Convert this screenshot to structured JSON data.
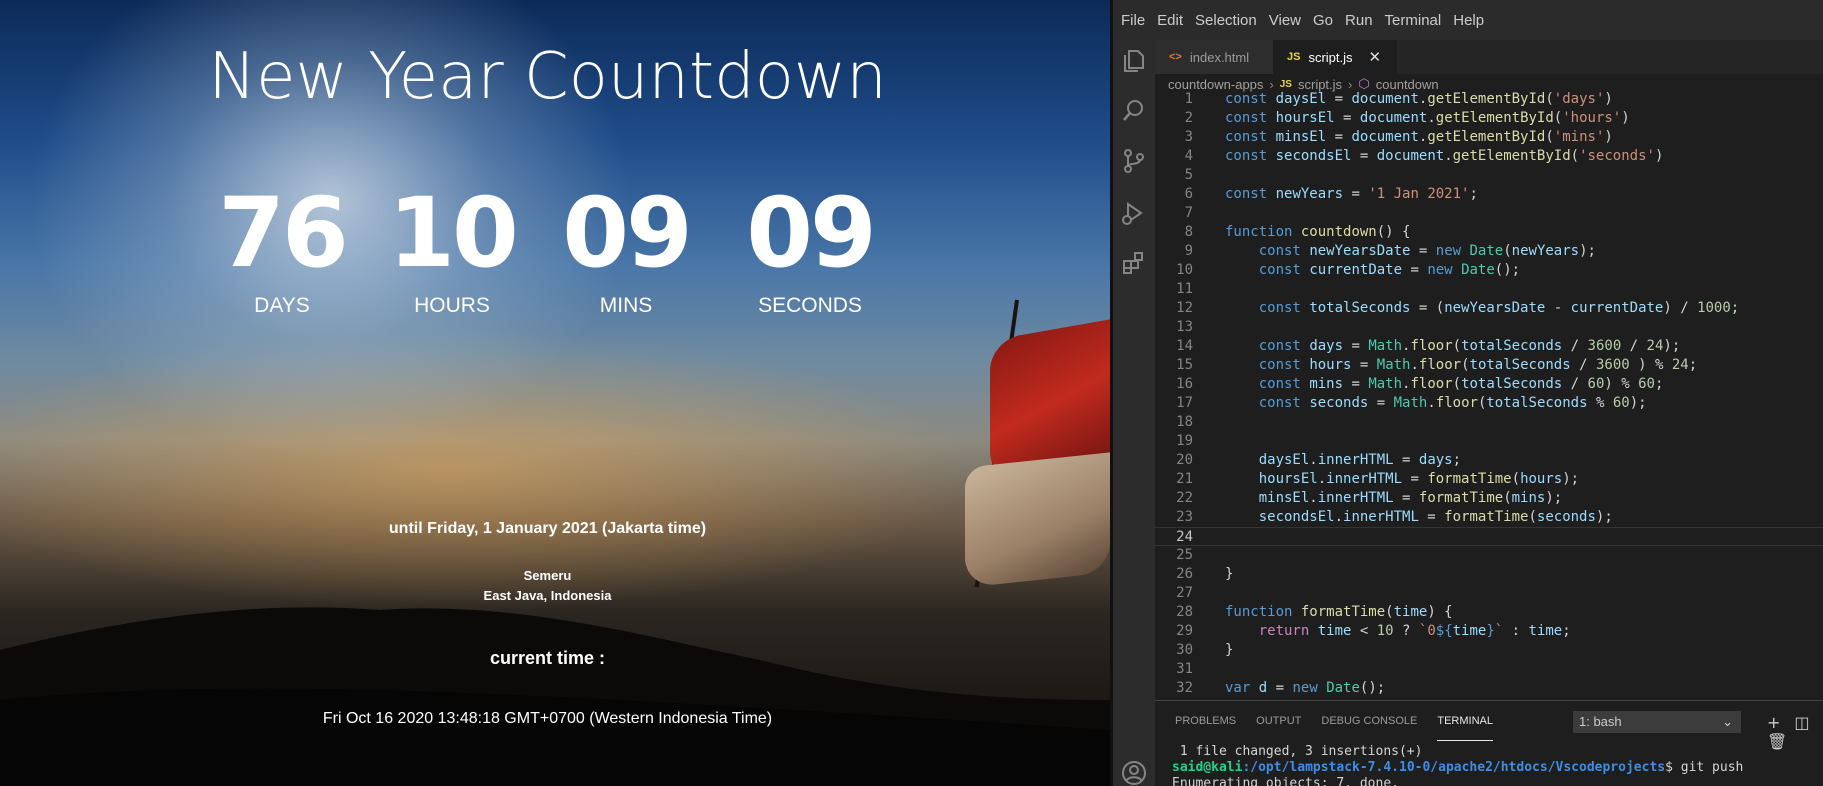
{
  "countdown": {
    "title": "New Year Countdown",
    "units": [
      {
        "value": "76",
        "label": "DAYS"
      },
      {
        "value": "10",
        "label": "HOURS"
      },
      {
        "value": "09",
        "label": "MINS"
      },
      {
        "value": "09",
        "label": "SECONDS"
      }
    ],
    "until": "until Friday, 1 January 2021 (Jakarta time)",
    "place_name": "Semeru",
    "place_region": "East Java, Indonesia",
    "current_time_label": "current time :",
    "current_time_value": "Fri Oct 16 2020 13:48:18 GMT+0700 (Western Indonesia Time)"
  },
  "vscode": {
    "menu": [
      "File",
      "Edit",
      "Selection",
      "View",
      "Go",
      "Run",
      "Terminal",
      "Help"
    ],
    "tabs": [
      {
        "label": "index.html",
        "icon": "<>",
        "active": false
      },
      {
        "label": "script.js",
        "icon": "JS",
        "active": true
      }
    ],
    "breadcrumb": {
      "folder": "countdown-apps",
      "file": "script.js",
      "symbol": "countdown",
      "file_icon": "JS"
    },
    "line_numbers": [
      "1",
      "2",
      "3",
      "4",
      "5",
      "6",
      "7",
      "8",
      "9",
      "10",
      "11",
      "12",
      "13",
      "14",
      "15",
      "16",
      "17",
      "18",
      "19",
      "20",
      "21",
      "22",
      "23",
      "24",
      "25",
      "26",
      "27",
      "28",
      "29",
      "30",
      "31",
      "32"
    ],
    "panel_tabs": [
      "PROBLEMS",
      "OUTPUT",
      "DEBUG CONSOLE",
      "TERMINAL"
    ],
    "terminal_select": "1: bash",
    "terminal": {
      "line1": " 1 file changed, 3 insertions(+)",
      "user": "said@kali",
      "path": ":/opt/lampstack-7.4.10-0/apache2/htdocs/Vscodeprojects",
      "command": "$ git push",
      "line3": "Enumerating objects: 7, done."
    }
  },
  "colors": {
    "editor_bg": "#1e1e1e",
    "keyword": "#569cd6",
    "variable": "#9cdcfe",
    "function": "#dcdcaa",
    "string": "#ce9178",
    "number": "#b5cea8",
    "class": "#4ec9b0"
  },
  "icons": [
    "files-icon",
    "search-icon",
    "source-control-icon",
    "run-debug-icon",
    "extensions-icon",
    "account-icon",
    "html-icon",
    "js-icon",
    "close-icon",
    "symbol-icon",
    "chevron-down-icon",
    "plus-icon",
    "split-icon",
    "trash-icon"
  ]
}
